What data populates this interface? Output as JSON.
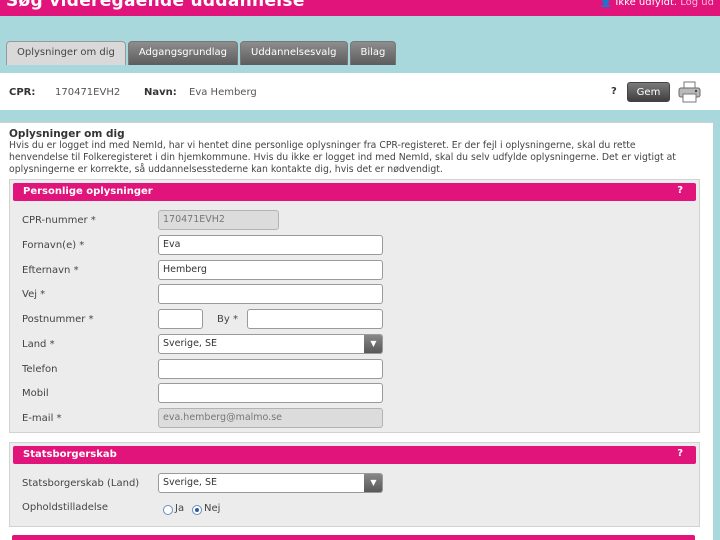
{
  "header": {
    "title": "Søg videregående uddannelse",
    "user_prefix": "Ikke udfyldt",
    "logout": "Log ud"
  },
  "tabs": [
    {
      "label": "Oplysninger om dig",
      "active": true
    },
    {
      "label": "Adgangsgrundlag",
      "active": false
    },
    {
      "label": "Uddannelsesvalg",
      "active": false
    },
    {
      "label": "Bilag",
      "active": false
    }
  ],
  "infobar": {
    "cpr_label": "CPR:",
    "cpr_value": "170471EVH2",
    "name_label": "Navn:",
    "name_value": "Eva Hemberg",
    "help": "?",
    "save_label": "Gem"
  },
  "intro": {
    "title": "Oplysninger om dig",
    "text": "Hvis du er logget ind med NemId, har vi hentet dine personlige oplysninger fra CPR-registeret. Er der fejl i oplysningerne, skal du rette henvendelse til Folkeregisteret i din hjemkommune. Hvis du ikke er logget ind med NemId, skal du selv udfylde oplysningerne. Det er vigtigt at oplysningerne er korrekte, så uddannelsesstederne kan kontakte dig, hvis det er nødvendigt."
  },
  "personal": {
    "title": "Personlige oplysninger",
    "help": "?",
    "fields": {
      "cpr": {
        "label": "CPR-nummer *",
        "value": "170471EVH2"
      },
      "fornavn": {
        "label": "Fornavn(e) *",
        "value": "Eva"
      },
      "efternavn": {
        "label": "Efternavn *",
        "value": "Hemberg"
      },
      "vej": {
        "label": "Vej *",
        "value": ""
      },
      "postnummer": {
        "label": "Postnummer *",
        "value": ""
      },
      "by": {
        "label": "By *",
        "value": ""
      },
      "land": {
        "label": "Land *",
        "value": "Sverige, SE"
      },
      "telefon": {
        "label": "Telefon",
        "value": ""
      },
      "mobil": {
        "label": "Mobil",
        "value": ""
      },
      "email": {
        "label": "E-mail *",
        "value": "eva.hemberg@malmo.se"
      }
    }
  },
  "citizenship": {
    "title": "Statsborgerskab",
    "help": "?",
    "country_label": "Statsborgerskab (Land)",
    "country_value": "Sverige, SE",
    "permit_label": "Opholdstilladelse",
    "option_yes": "Ja",
    "option_no": "Nej",
    "selected": "Nej"
  },
  "colors": {
    "brand": "#e0147a",
    "background": "#a8d8dc"
  }
}
